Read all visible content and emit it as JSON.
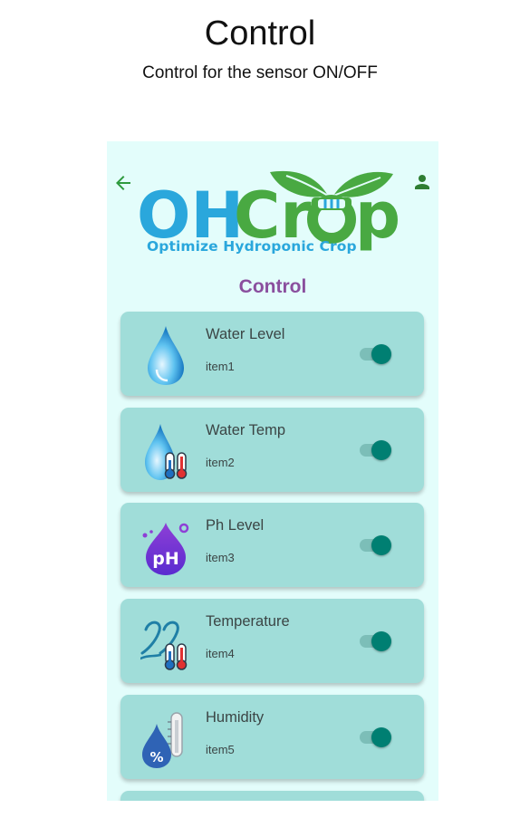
{
  "page": {
    "title": "Control",
    "subtitle": "Control for the sensor ON/OFF"
  },
  "app": {
    "logo": {
      "word_oh": "OH",
      "word_cr": "Cr",
      "word_p": "p",
      "tagline": "Optimize Hydroponic Crop"
    },
    "screen_title": "Control",
    "colors": {
      "background": "#e3fdfb",
      "card": "#a0ddd9",
      "accent_green": "#2e9a3e",
      "logo_blue": "#2aa7dc",
      "logo_green": "#49a942",
      "title_purple": "#8a4f9e",
      "toggle_on": "#007f72"
    },
    "icons": {
      "back": "arrow-left-icon",
      "profile": "person-icon"
    },
    "controls": [
      {
        "title": "Water Level",
        "subtitle": "item1",
        "icon": "water-drop-icon",
        "enabled": true
      },
      {
        "title": "Water Temp",
        "subtitle": "item2",
        "icon": "water-temperature-icon",
        "enabled": true
      },
      {
        "title": "Ph Level",
        "subtitle": "item3",
        "icon": "ph-drop-icon",
        "enabled": true
      },
      {
        "title": "Temperature",
        "subtitle": "item4",
        "icon": "air-temperature-icon",
        "enabled": true
      },
      {
        "title": "Humidity",
        "subtitle": "item5",
        "icon": "humidity-icon",
        "enabled": true
      }
    ]
  }
}
